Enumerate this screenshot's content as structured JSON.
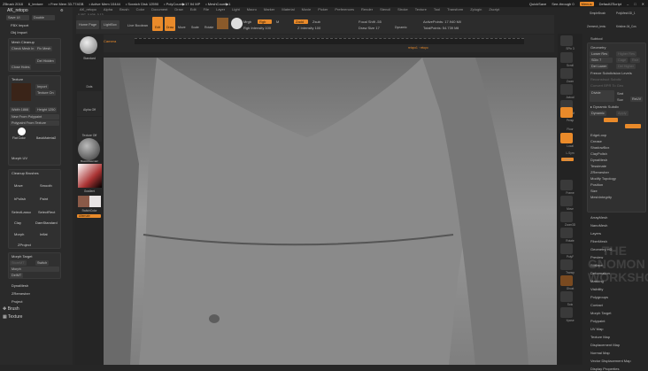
{
  "titlebar": {
    "app": "ZBrush 2018",
    "file": "6_texture",
    "free_mem": "• Free Mem 33.774GB",
    "active_mem": "• Active Mem 10444",
    "scratch": "• Scratch Disk 12590",
    "polycount": "• PolyCount▶17.94 MP",
    "meshcount": "• MeshCount▶1",
    "quicksave": "QuickSave",
    "seethrough": "See-through 0",
    "menus": "Menus",
    "defaultzscript": "DefaultZScript"
  },
  "menu": [
    "AK_retopo",
    "Alpha",
    "Brush",
    "Color",
    "Document",
    "Draw",
    "Edit",
    "File",
    "Layer",
    "Light",
    "Macro",
    "Marker",
    "Material",
    "Movie",
    "Picker",
    "Preferences",
    "Render",
    "Stencil",
    "Stroke",
    "Texture",
    "Tool",
    "Transform",
    "Zplugin",
    "Zscript"
  ],
  "coords": "0.057,-0.636,-0.13",
  "toolbar": {
    "home": "Home Page",
    "lightbox": "LightBox",
    "live_boolean": "Live Boolean",
    "edit": "Edit",
    "draw": "Draw",
    "move": "Move",
    "scale": "Scale",
    "rotate": "Rotate",
    "mrgb": "Mrgb",
    "rgb": "Rgb",
    "m": "M",
    "zadd": "Zadd",
    "zsub": "Zsub",
    "rgb_intensity": "Rgb Intensity 100",
    "z_intensity": "Z Intensity 100",
    "focal_shift": "Focal Shift -55",
    "draw_size": "Draw Size 17",
    "dynamic": "Dynamic",
    "active_points": "ActivePoints: 17.940 Mil",
    "total_points": "TotalPoints: 54.739 Mil"
  },
  "timeline": {
    "label": "Camera",
    "marker": "retopo1 · retopo"
  },
  "left": {
    "palette": "AK_retopo",
    "save_ui": "Save UI",
    "double": "Double",
    "fbx": "FBX Import",
    "obj": "Obj Import",
    "mesh_cleanup": "Mesh Cleanup",
    "check_mesh": "Check Mesh In",
    "fix_mesh": "Fix Mesh",
    "del_hidden": "Del Hidden",
    "close_holes": "Close Holes",
    "texture": "Texture",
    "import": "Import",
    "texture_on": "Texture On",
    "width": "Width 1866",
    "height": "Height 1250",
    "new_from_polypaint": "New From Polypaint",
    "polypaint_from_texture": "Polypaint From Texture",
    "flat_color": "Flat Color",
    "basic_material": "BasicMaterial2",
    "morph_uv": "Morph UV",
    "cleanup_brushes": "Cleanup Brushes",
    "brushes": [
      "Move",
      "Smooth",
      "hPolish",
      "Paint",
      "SelectLasso",
      "SelectRect",
      "Clay",
      "DamStandard",
      "Morph",
      "Inflat",
      "ZProject"
    ],
    "morph_target": "Morph Target",
    "storemt": "StoreMT",
    "switch": "Switch",
    "morph": "Morph",
    "delmt": "DelMT",
    "dynamesh": "DynaMesh",
    "zremesher": "ZRemesher",
    "project": "Project",
    "brush": "Brush",
    "texture_menu": "Texture"
  },
  "shelf_left": {
    "standard": "Standard",
    "dots": "Dots",
    "alpha_off": "Alpha Off",
    "texture_off": "Texture Off",
    "material": "BasicMaterial2",
    "gradient": "Gradient",
    "switchcolor": "SwitchColor",
    "alternate": "Alternate"
  },
  "shelf_right": [
    "SPix 3",
    "Scroll",
    "Zoom",
    "Actual",
    "AAHalf",
    "Persp",
    "Floor",
    "Local",
    "L.Sym",
    "Qxyz",
    "Frame",
    "Move",
    "Zoom3D",
    "Rotate",
    "PolyF",
    "Transp",
    "Ghost",
    "Solo",
    "Xpose"
  ],
  "right": {
    "tools": [
      "SimpleBrush",
      "PolyMesh3D_1",
      "Zremesh_textu",
      "Kristine-04_Cos"
    ],
    "subtool": "Subtool",
    "geometry": "Geometry",
    "lower_res": "Lower Res",
    "higher_res": "Higher Res",
    "sdiv": "SDiv 7",
    "cage": "Cage",
    "rstr": "Rstr",
    "del_lower": "Del Lower",
    "del_higher": "Del Higher",
    "freeze": "Freeze Subdivision Levels",
    "reconstruct": "Reconstruct Subdiv",
    "convert_bpr": "Convert BPR To Geo",
    "divide": "Divide",
    "smt": "Smt",
    "suv": "Suv",
    "reuv": "ReUV",
    "dynamic_subdiv": "Dynamic Subdiv",
    "dynamic": "Dynamic",
    "apply": "Apply",
    "items": [
      "EdgeLoop",
      "Crease",
      "ShadowBox",
      "ClayPolish",
      "DynaMesh",
      "Tessimate",
      "ZRemesher",
      "Modify Topology",
      "Position",
      "Size",
      "MeshIntegrity"
    ],
    "sections": [
      "ArrayMesh",
      "NanoMesh",
      "Layers",
      "FiberMesh",
      "Geometry HD",
      "Preview",
      "Surface",
      "Deformation",
      "Masking",
      "Visibility",
      "Polygroups",
      "Contact",
      "Morph Target",
      "Polypaint",
      "UV Map",
      "Texture Map",
      "Displacement Map",
      "Normal Map",
      "Vector Displacement Map",
      "Display Properties"
    ]
  },
  "watermark": "THE GNOMON WORKSHOP",
  "colors": {
    "accent": "#e98a2a",
    "panel": "#2a2a2a"
  }
}
